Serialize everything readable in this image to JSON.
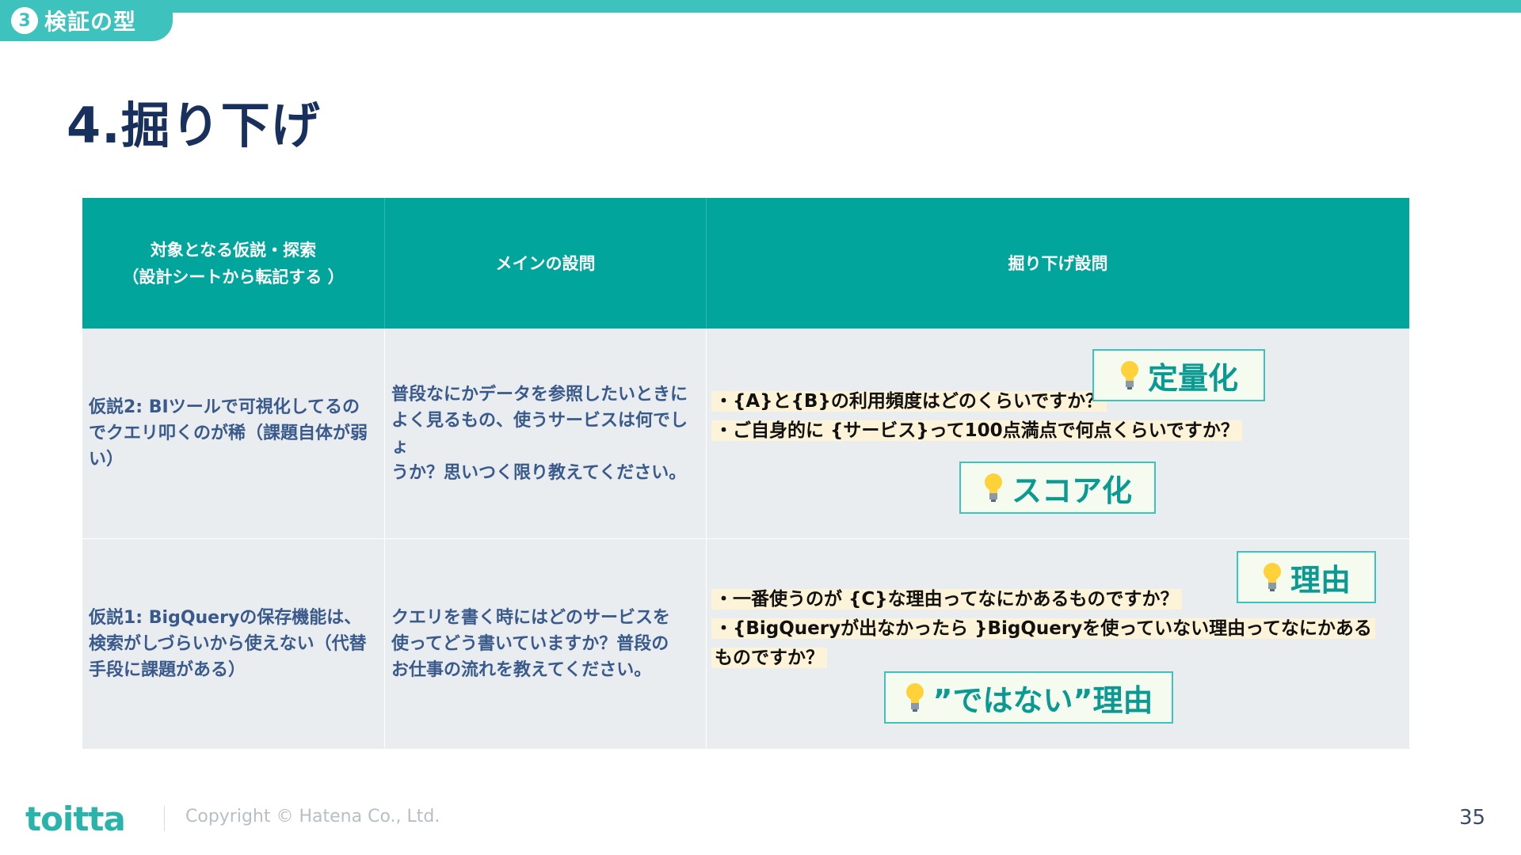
{
  "section": {
    "number": "3",
    "label": "検証の型"
  },
  "title": "4.掘り下げ",
  "table": {
    "headers": [
      "対象となる仮説・探索\n（設計シートから転記する ）",
      "メインの設問",
      "掘り下げ設問"
    ],
    "rows": [
      {
        "hypothesis": [
          "仮説2: BIツールで可視化してるの",
          "でクエリ叩くのが稀（課題自体が弱",
          "い）"
        ],
        "main_question": [
          "普段なにかデータを参照したいときに",
          "よく見るもの、使うサービスは何でしょ",
          "うか？思いつく限り教えてください。"
        ],
        "followups": [
          "・{A}と{B}の利用頻度はどのくらいですか？",
          "・ご自身的に {サービス}って100点満点で何点くらいですか？"
        ],
        "callouts": [
          "定量化",
          "スコア化"
        ]
      },
      {
        "hypothesis": [
          "仮説1: BigQueryの保存機能は、",
          "検索がしづらいから使えない（代替",
          "手段に課題がある）"
        ],
        "main_question": [
          "クエリを書く時にはどのサービスを",
          "使ってどう書いていますか？普段の",
          "お仕事の流れを教えてください。"
        ],
        "followups": [
          "・一番使うのが {C}な理由ってなにかあるものですか？",
          "・{BigQueryが出なかったら }BigQueryを使っていない理由ってなにかある",
          "ものですか？"
        ],
        "callouts": [
          "理由",
          "”ではない”理由"
        ]
      }
    ]
  },
  "footer": {
    "logo": "toitta",
    "copyright": "Copyright © Hatena Co., Ltd.",
    "page": "35"
  },
  "colors": {
    "teal": "#01a59b",
    "accent": "#3ec2bd",
    "navy": "#18305c",
    "cell_bg": "#e9edef",
    "highlight": "#fdf3d9"
  },
  "icons": {
    "callout_icon": "lightbulb-icon"
  }
}
